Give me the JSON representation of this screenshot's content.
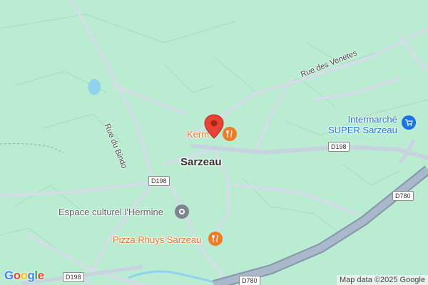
{
  "map": {
    "town": "Sarzeau",
    "roads": {
      "rue_bindo": "Rue du Bindo",
      "rue_venetes": "Rue des Venetes",
      "d198": "D198",
      "d780": "D780"
    },
    "pois": {
      "kerm": "Kerm",
      "espace": "Espace culturel l'Hermine",
      "pizza": "Pizza Rhuys Sarzeau",
      "intermarche_line1": "Intermarché",
      "intermarche_line2": "SUPER Sarzeau"
    },
    "colors": {
      "land": "#b9ecd0",
      "restaurant": "#f07b25",
      "shop": "#1a73e8",
      "pin": "#ea4335",
      "water": "#8fd3ef"
    },
    "icons": {
      "restaurant": "fork-knife-icon",
      "shop": "shopping-cart-icon",
      "culture": "landmark-dot-icon",
      "pin": "location-pin-icon"
    }
  },
  "branding": {
    "logo": "Google",
    "attribution": "Map data ©2025 Google"
  }
}
